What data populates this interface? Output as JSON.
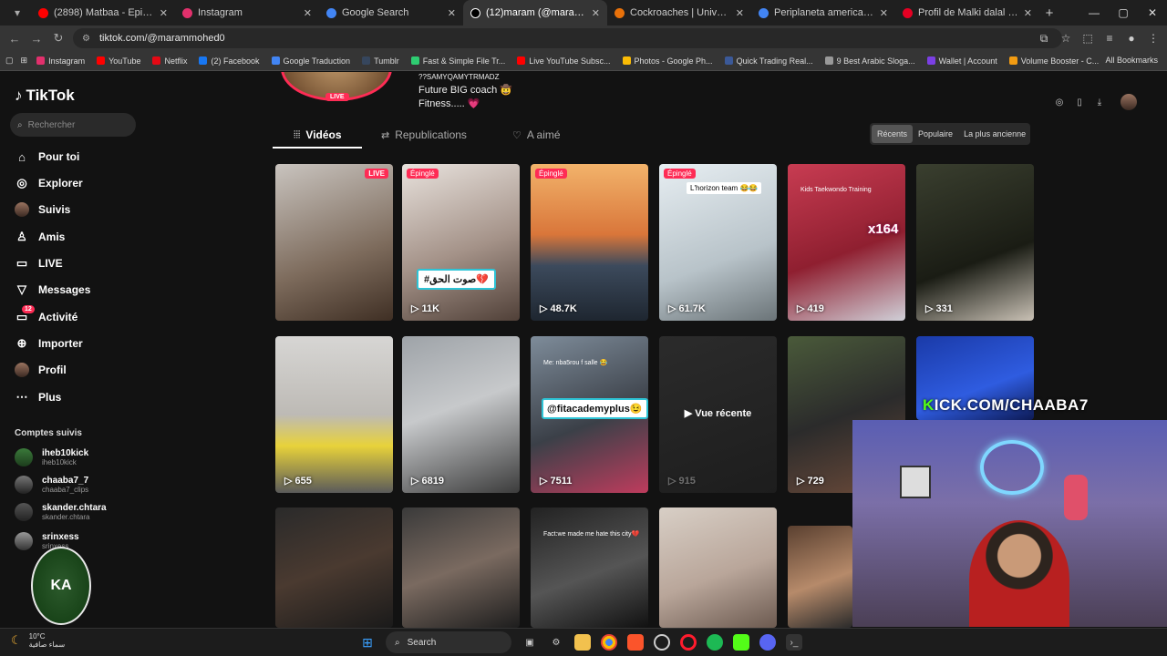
{
  "browser": {
    "tabs": [
      {
        "title": "(2898) Matbaa - Episode 2 | 2 ...",
        "color": "#ff0000",
        "active": false
      },
      {
        "title": "Instagram",
        "color": "#e1306c",
        "active": false
      },
      {
        "title": "Google Search",
        "color": "#4285f4",
        "active": false
      },
      {
        "title": "(12)maram (@marammohed0)",
        "color": "#000000",
        "active": true
      },
      {
        "title": "Cockroaches | University of Ma...",
        "color": "#e8710a",
        "active": false
      },
      {
        "title": "Periplaneta americana - Google...",
        "color": "#4285f4",
        "active": false
      },
      {
        "title": "Profil de Malki dalal (malkidala...",
        "color": "#e60023",
        "active": false
      }
    ],
    "url": "tiktok.com/@marammohed0",
    "bookmarks": [
      {
        "label": "Instagram",
        "color": "#e1306c"
      },
      {
        "label": "YouTube",
        "color": "#ff0000"
      },
      {
        "label": "Netflix",
        "color": "#e50914"
      },
      {
        "label": "(2) Facebook",
        "color": "#1877f2"
      },
      {
        "label": "Google Traduction",
        "color": "#4285f4"
      },
      {
        "label": "Tumblr",
        "color": "#36465d"
      },
      {
        "label": "Fast & Simple File Tr...",
        "color": "#2ecc71"
      },
      {
        "label": "Live YouTube Subsc...",
        "color": "#ff0000"
      },
      {
        "label": "Photos - Google Ph...",
        "color": "#fbbc05"
      },
      {
        "label": "Quick Trading Real...",
        "color": "#3b5998"
      },
      {
        "label": "9 Best Arabic Sloga...",
        "color": "#999999"
      },
      {
        "label": "Wallet | Account",
        "color": "#7b3fe4"
      },
      {
        "label": "Volume Booster - C...",
        "color": "#f39c12"
      }
    ],
    "all_bookmarks": "All Bookmarks"
  },
  "sidebar": {
    "logo": "TikTok",
    "search_placeholder": "Rechercher",
    "nav": [
      "Pour toi",
      "Explorer",
      "Suivis",
      "Amis",
      "LIVE",
      "Messages",
      "Activité",
      "Importer",
      "Profil",
      "Plus"
    ],
    "activity_badge": "12",
    "followed_title": "Comptes suivis",
    "followed": [
      {
        "name": "iheb10kick",
        "sub": "iheb10kick"
      },
      {
        "name": "chaaba7_7",
        "sub": "chaaba7_clips"
      },
      {
        "name": "skander.chtara",
        "sub": "skander.chtara"
      },
      {
        "name": "srinxess",
        "sub": "srinxess"
      }
    ]
  },
  "profile": {
    "live_tag": "LIVE",
    "bio": [
      "??SAMYQAMYTRMADZ",
      "Future BIG coach 🤠",
      "Fitness..... 💗"
    ],
    "tabs": [
      "Vidéos",
      "Republications",
      "A aimé"
    ],
    "sort": [
      "Récents",
      "Populaire",
      "La plus ancienne"
    ]
  },
  "videos": [
    {
      "count": "",
      "pin": "",
      "live": "LIVE",
      "bg": "linear-gradient(160deg,#c9c4bf,#7d6b5c 60%,#3f2f24)"
    },
    {
      "count": "11K",
      "pin": "Épinglé",
      "caption": "#صوت الحق💔",
      "bg": "linear-gradient(160deg,#e8e2dd,#a49288 55%,#504038)"
    },
    {
      "count": "48.7K",
      "pin": "Épinglé",
      "bg": "linear-gradient(180deg,#f2b36b,#d9763a 45%,#3c4a5c 65%,#1e2630)"
    },
    {
      "count": "61.7K",
      "pin": "Épinglé",
      "overlay": "L'horizon team 😂😂",
      "bg": "linear-gradient(160deg,#e7eef2,#b8c3c9 60%,#6b7478)"
    },
    {
      "count": "419",
      "pin": "",
      "tiny": "Kids Taekwondo Training",
      "bg": "linear-gradient(160deg,#c83c52,#8f1f30 55%,#d0d0d8)"
    },
    {
      "count": "331",
      "pin": "",
      "bg": "linear-gradient(160deg,#3a3f2f,#1a1c14 60%,#c9c1b5)"
    },
    {
      "count": "655",
      "pin": "",
      "bg": "linear-gradient(180deg,#d7d6d4,#bdbab5 50%,#e8d23a 70%,#5a5a5a)"
    },
    {
      "count": "6819",
      "pin": "",
      "bg": "linear-gradient(160deg,#9ea3a8,#c7c9cb 45%,#3c3c3c)"
    },
    {
      "count": "7511",
      "pin": "",
      "caption2": "@fitacademyplus😉",
      "tiny": "Me: nba5rou f salle 😂",
      "bg": "linear-gradient(160deg,#7e8c9a,#3b4048 55%,#be3c5d)"
    },
    {
      "count": "915",
      "pin": "",
      "recent": "▶ Vue récente",
      "bg": "linear-gradient(160deg,#2b2b2b,#1d1d1d)"
    },
    {
      "count": "729",
      "pin": "",
      "bg": "linear-gradient(160deg,#4a5a3a,#2b2b2b 50%,#6d4b3a)"
    },
    {
      "count": "",
      "pin": "",
      "bg": "linear-gradient(160deg,#1a3aa8,#2f5ce0 60%,#0d1a55)"
    },
    {
      "count": "",
      "pin": "",
      "bg": "linear-gradient(160deg,#2a2a2a,#4a3a30 50%,#1a1a1a)"
    },
    {
      "count": "",
      "pin": "",
      "bg": "linear-gradient(160deg,#3a3a3a,#7a6a60 50%,#1d1d1d)"
    },
    {
      "count": "",
      "pin": "",
      "tiny": "Fact:we made me hate this city💔",
      "bg": "linear-gradient(160deg,#222,#555 55%,#111)"
    },
    {
      "count": "",
      "pin": "",
      "bg": "linear-gradient(160deg,#d8cfc6,#b9a69a 55%,#6c5a50)"
    },
    {
      "count": "",
      "pin": "",
      "bg": "linear-gradient(160deg,#5a4030,#b68a6a 55%,#2a2a2a)"
    }
  ],
  "stream_overlay": {
    "counter": "x164",
    "kick_prefix": "K",
    "kick_text": "ICK.COM/CHAABA7",
    "emblem": "KA"
  },
  "taskbar": {
    "temp": "10°C",
    "weather": "سماء صافية",
    "search": "Search"
  }
}
